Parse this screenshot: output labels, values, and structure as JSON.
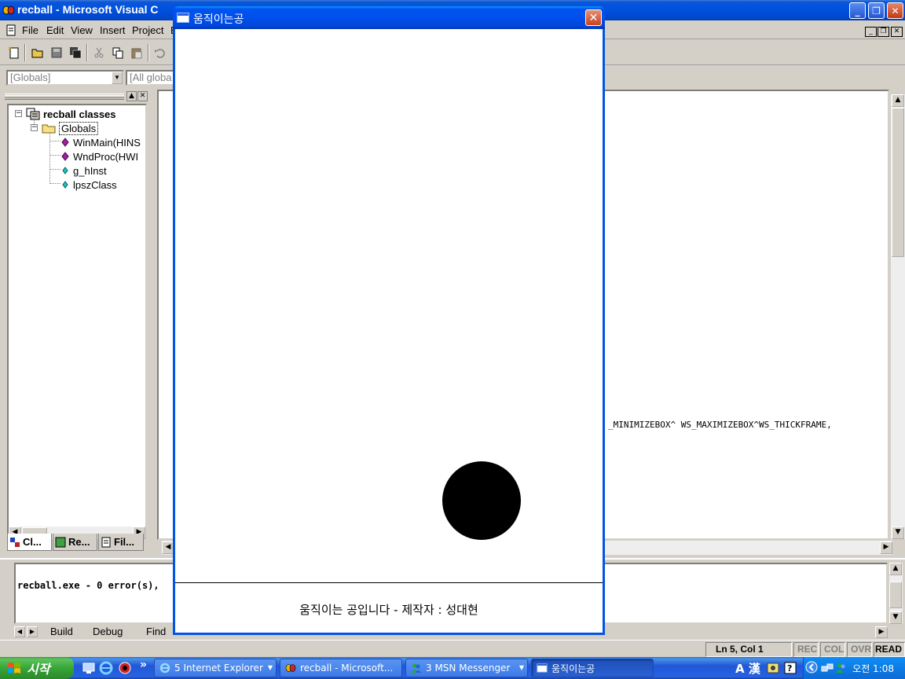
{
  "vc_window": {
    "title": "recball - Microsoft Visual C++ [recball]",
    "title_visible": "recball - Microsoft Visual C",
    "title_fragment": "[ ]"
  },
  "menu": {
    "items": [
      "File",
      "Edit",
      "View",
      "Insert",
      "Project",
      "B"
    ]
  },
  "wizard_bar": {
    "class_combo": "[Globals]",
    "filter_combo": "[All globa"
  },
  "workspace": {
    "root": "recball classes",
    "folder": "Globals",
    "members": [
      {
        "label": "WinMain(HINS",
        "icon": "method-icon"
      },
      {
        "label": "WndProc(HWI",
        "icon": "method-icon"
      },
      {
        "label": "g_hInst",
        "icon": "variable-icon"
      },
      {
        "label": "lpszClass",
        "icon": "variable-icon"
      }
    ],
    "tabs": [
      "Cl...",
      "Re...",
      "Fil..."
    ]
  },
  "editor": {
    "code_line": "_MINIMIZEBOX^ WS_MAXIMIZEBOX^WS_THICKFRAME,"
  },
  "output": {
    "text": "recball.exe - 0 error(s),",
    "tabs": [
      "Build",
      "Debug",
      "Find"
    ]
  },
  "status_bar": {
    "position": "Ln 5, Col 1",
    "indicators": [
      "REC",
      "COL",
      "OVR",
      "READ"
    ]
  },
  "dialog": {
    "title": "움직이는공",
    "caption": "움직이는 공입니다 - 제작자 : 성대현"
  },
  "taskbar": {
    "start_label": "시작",
    "chevron": "»",
    "buttons": [
      "5 Internet Explorer",
      "recball - Microsoft...",
      "3 MSN Messenger",
      "움직이는공"
    ],
    "ime": "A 漢",
    "clock": "오전 1:08"
  },
  "colors": {
    "xp_blue": "#0055e5",
    "ball": "#000000",
    "start_green": "#37a537"
  }
}
